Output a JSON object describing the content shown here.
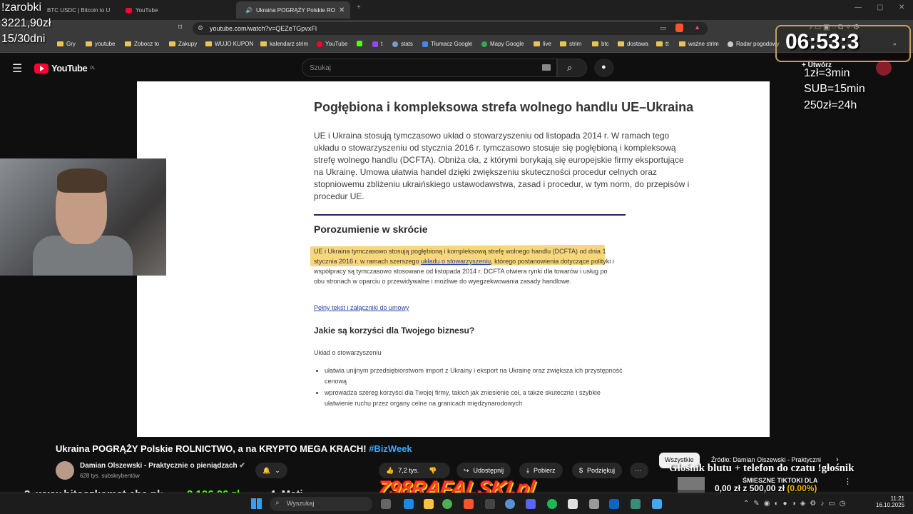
{
  "browser": {
    "tabs": [
      {
        "label": "BTC USDC | Bitcoin to U"
      },
      {
        "label": "YouTube"
      },
      {
        "label": "Ukraina POGRĄŻY Polskie RO"
      }
    ],
    "new_tab": "+",
    "url": "youtube.com/watch?v=QEZeTGpvxFI",
    "bookmarks": [
      "Gry",
      "youtube",
      "Zobocz to",
      "Zakupy",
      "WUJO KUPON",
      "kalendarz strim",
      "YouTube",
      "t",
      "stats",
      "Tłumacz Google",
      "Mapy Google",
      "live",
      "strim",
      "btc",
      "dostawa",
      "tt",
      "ważne strim",
      "Radar pogodowy"
    ],
    "bookmarks_more": "»"
  },
  "youtube": {
    "logo_text": "YouTube",
    "logo_region": "PL",
    "search_placeholder": "Szukaj",
    "create_label": "Utwórz"
  },
  "video": {
    "title": "Pogłębiona i kompleksowa strefa wolnego handlu UE–Ukraina",
    "intro": "UE i Ukraina stosują tymczasowo układ o stowarzyszeniu od listopada 2014 r. W ramach tego układu o stowarzyszeniu od stycznia 2016 r. tymczasowo stosuje się pogłębioną i kompleksową strefę wolnego handlu (DCFTA). Obniża cła, z którymi borykają się europejskie firmy eksportujące na Ukrainę. Umowa ułatwia handel dzięki zwiększeniu skuteczności procedur celnych oraz stopniowemu zbliżeniu ukraińskiego ustawodawstwa, zasad i procedur, w tym norm, do przepisów i procedur UE.",
    "section1": "Porozumienie w skrócie",
    "para_highlight": "UE i Ukraina tymczasowo stosują pogłębioną i kompleksową strefę wolnego handlu (DCFTA) od dnia 1 stycznia 2016 r. w ramach szerszego",
    "para_link": "układu o stowarzyszeniu",
    "para_rest": ", którego postanowienia dotyczące polityki i współpracy są tymczasowo stosowane od listopada 2014 r. DCFTA otwiera rynki dla towarów i usług po obu stronach w oparciu o przewidywalne i możliwe do wyegzekwowania zasady handlowe.",
    "full_text_link": "Pełny tekst i załączniki do umowy",
    "section2": "Jakie są korzyści dla Twojego biznesu?",
    "subhead": "Układ o stowarzyszeniu",
    "bullets": [
      "ułatwia unijnym przedsiębiorstwom import z Ukrainy i eksport na Ukrainę oraz zwiększa ich przystępność cenową",
      "wprowadza szereg korzyści dla Twojej firmy, takich jak zniesienie ceł, a także skuteczne i szybkie ułatwienie ruchu przez organy celne na granicach międzynarodowych"
    ]
  },
  "overlay": {
    "zarobki_label": "!zarobki",
    "zarobki_value": "3221,90zł",
    "days": "15/30dni",
    "timer": "06:53:3",
    "rates": [
      "1zł=3min",
      "SUB=15min",
      "250zł=24h"
    ],
    "ticker_left": "3. www.hitoszkomat.cba.pl:",
    "ticker_amount": "2 106,06 zł",
    "ticker_next": "4. Mati",
    "brand": "798RAFALSKI.pl",
    "right_marquee": "Głośnik blutu + telefon do czatu !głośnik",
    "tiktok_label": "ŚMIESZNE TIKTOKI DLA",
    "goal_text": "0,00 zł z 500,00 zł",
    "goal_pct": "(0.00%)"
  },
  "watch": {
    "title": "Ukraina POGRĄŻY Polskie ROLNICTWO, a na KRYPTO MEGA KRACH!",
    "hashtag": "#BizWeek",
    "channel": "Damian Olszewski - Praktycznie o pieniądzach",
    "subscribers": "628 tys. subskrybentów",
    "likes": "7,2 tys.",
    "share": "Udostępnij",
    "download": "Pobierz",
    "thanks": "Podziękuj",
    "chip_all": "Wszystkie",
    "chip_source": "Źródło: Damian Olszewski - Praktyczni"
  },
  "taskbar": {
    "search_placeholder": "Wyszukaj",
    "time": "11:21",
    "date": "16.10.2025"
  }
}
